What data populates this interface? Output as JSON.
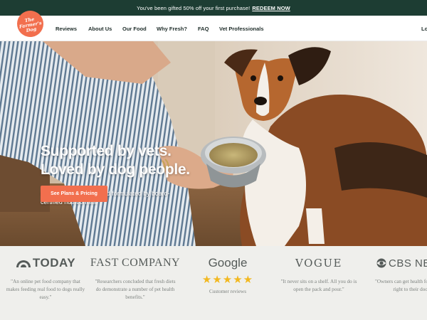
{
  "promo": {
    "text": "You've been gifted 50% off your first purchase!",
    "link": "REDEEM NOW"
  },
  "brand": {
    "logo_line1": "The",
    "logo_line2": "Farmer's",
    "logo_line3": "Dog",
    "color": "#f26f4e"
  },
  "nav": {
    "items": [
      "Reviews",
      "About Us",
      "Our Food",
      "Why Fresh?",
      "FAQ",
      "Vet Professionals"
    ],
    "login": "Lo"
  },
  "hero": {
    "title_line1": "Supported by vets.",
    "title_line2": "Loved by dog people.",
    "subtitle": "Gently cooked fresh food formulated by board-certified nutritionists.",
    "cta": "See Plans & Pricing"
  },
  "press": [
    {
      "logo": "TODAY",
      "icon": "nbc-peacock-icon",
      "quote": "\"An online pet food company that makes feeding real food to dogs really easy.\""
    },
    {
      "logo": "FAST COMPANY",
      "quote": "\"Researchers concluded that fresh diets do demonstrate a number of pet health benefits.\""
    },
    {
      "logo": "Google",
      "stars": "★★★★★",
      "caption": "Customer reviews"
    },
    {
      "logo": "VOGUE",
      "quote": "\"It never sits on a shelf. All you do is open the pack and pour.\""
    },
    {
      "logo": "CBS NE",
      "icon": "cbs-eye-icon",
      "quote": "\"Owners can get health food shipped right to their door.\""
    }
  ],
  "colors": {
    "promo_bg": "#1d3d33",
    "accent": "#f26f4e",
    "press_bg": "#efefec",
    "star": "#f2b81f"
  }
}
